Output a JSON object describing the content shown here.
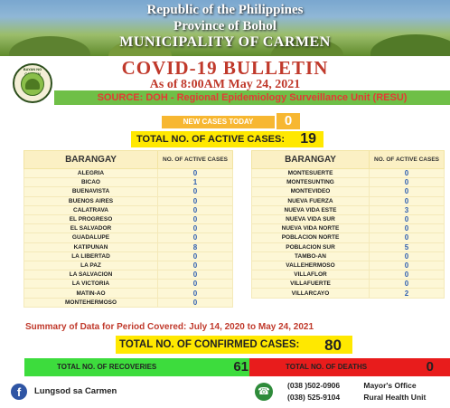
{
  "header": {
    "republic": "Republic of the Philippines",
    "province": "Province of Bohol",
    "municipality": "MUNICIPALITY OF CARMEN"
  },
  "seal": {
    "top_text": "BAYAN NG CARMEN",
    "bottom_text": "LALAWIGAN NG BOHOL"
  },
  "bulletin": {
    "title": "COVID-19 BULLETIN",
    "date": "As of 8:00AM May 24, 2021"
  },
  "source": "SOURCE: DOH - Regional Epidemiology Surveillance Unit (RESU)",
  "new_cases": {
    "label": "NEW CASES TODAY",
    "value": "0"
  },
  "active_cases": {
    "label": "TOTAL NO. OF ACTIVE CASES:",
    "value": "19"
  },
  "table_headers": {
    "name": "BARANGAY",
    "value": "NO. OF ACTIVE CASES"
  },
  "barangays_left": [
    {
      "name": "ALEGRIA",
      "value": "0"
    },
    {
      "name": "BICAO",
      "value": "1"
    },
    {
      "name": "BUENAVISTA",
      "value": "0"
    },
    {
      "name": "BUENOS AIRES",
      "value": "0"
    },
    {
      "name": "CALATRAVA",
      "value": "0"
    },
    {
      "name": "EL PROGRESO",
      "value": "0"
    },
    {
      "name": "EL SALVADOR",
      "value": "0"
    },
    {
      "name": "GUADALUPE",
      "value": "0"
    },
    {
      "name": "KATIPUNAN",
      "value": "8"
    },
    {
      "name": "LA LIBERTAD",
      "value": "0"
    },
    {
      "name": "LA PAZ",
      "value": "0"
    },
    {
      "name": "LA SALVACION",
      "value": "0"
    },
    {
      "name": "LA VICTORIA",
      "value": "0"
    },
    {
      "name": "MATIN-AO",
      "value": "0"
    },
    {
      "name": "MONTEHERMOSO",
      "value": "0"
    }
  ],
  "barangays_right": [
    {
      "name": "MONTESUERTE",
      "value": "0"
    },
    {
      "name": "MONTESUNTING",
      "value": "0"
    },
    {
      "name": "MONTEVIDEO",
      "value": "0"
    },
    {
      "name": "NUEVA FUERZA",
      "value": "0"
    },
    {
      "name": "NUEVA VIDA ESTE",
      "value": "3"
    },
    {
      "name": "NUEVA VIDA SUR",
      "value": "0"
    },
    {
      "name": "NUEVA VIDA NORTE",
      "value": "0"
    },
    {
      "name": "POBLACION NORTE",
      "value": "0"
    },
    {
      "name": "POBLACION SUR",
      "value": "5"
    },
    {
      "name": "TAMBO-AN",
      "value": "0"
    },
    {
      "name": "VALLEHERMOSO",
      "value": "0"
    },
    {
      "name": "VILLAFLOR",
      "value": "0"
    },
    {
      "name": "VILLAFUERTE",
      "value": "0"
    },
    {
      "name": "VILLARCAYO",
      "value": "2"
    }
  ],
  "summary": "Summary of Data for Period Covered: July 14, 2020 to May 24, 2021",
  "confirmed": {
    "label": "TOTAL NO. OF CONFIRMED CASES:",
    "value": "80"
  },
  "recoveries": {
    "label": "TOTAL NO. OF RECOVERIES",
    "value": "61"
  },
  "deaths": {
    "label": "TOTAL NO. OF DEATHS",
    "value": "0"
  },
  "footer": {
    "facebook_icon": "facebook-icon",
    "facebook_page": "Lungsod sa Carmen",
    "phone_icon": "phone-icon",
    "contacts": [
      {
        "number": "(038 )502-0906",
        "office": "Mayor's Office"
      },
      {
        "number": "(038) 525-9104",
        "office": "Rural Health Unit"
      }
    ]
  },
  "colors": {
    "title_red": "#c0392b",
    "source_green": "#6fbf47",
    "highlight_yellow": "#ffe800",
    "new_cases_orange": "#f7b731",
    "recoveries_green": "#3ddc3d",
    "deaths_red": "#e81c1c",
    "value_blue": "#2f5fb0"
  }
}
